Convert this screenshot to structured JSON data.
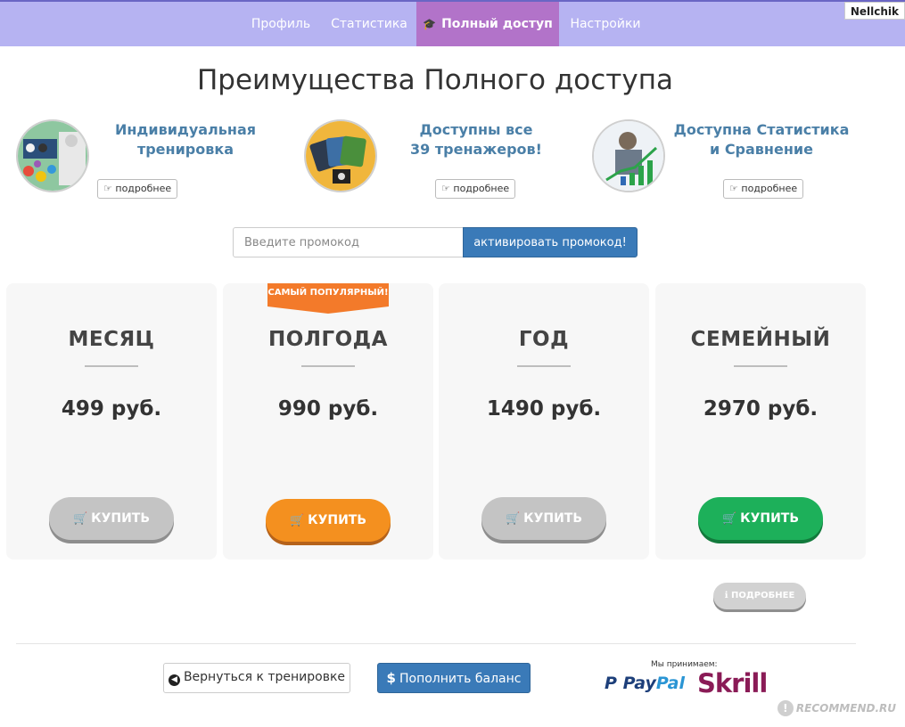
{
  "nav": {
    "items": [
      {
        "label": "Профиль"
      },
      {
        "label": "Статистика"
      },
      {
        "label": "Полный доступ"
      },
      {
        "label": "Настройки"
      }
    ],
    "active_index": 2,
    "user": "Nellchik"
  },
  "page": {
    "title": "Преимущества Полного доступа"
  },
  "features": [
    {
      "title_line1": "Индивидуальная",
      "title_line2": "тренировка",
      "more": "подробнее"
    },
    {
      "title_line1": "Доступны все",
      "title_line2": "39 тренажеров!",
      "more": "подробнее"
    },
    {
      "title_line1": "Доступна Статистика",
      "title_line2": "и Сравнение",
      "more": "подробнее"
    }
  ],
  "promo": {
    "placeholder": "Введите промокод",
    "button": "активировать промокод!"
  },
  "plans": [
    {
      "name": "МЕСЯЦ",
      "price": "499 руб.",
      "buy": "КУПИТЬ",
      "style": "gray"
    },
    {
      "name": "ПОЛГОДА",
      "price": "990 руб.",
      "buy": "КУПИТЬ",
      "style": "orange"
    },
    {
      "name": "ГОД",
      "price": "1490 руб.",
      "buy": "КУПИТЬ",
      "style": "gray"
    },
    {
      "name": "СЕМЕЙНЫЙ",
      "price": "2970 руб.",
      "buy": "КУПИТЬ",
      "style": "green"
    }
  ],
  "popular_ribbon": "САМЫЙ ПОПУЛЯРНЫЙ!",
  "family_details": "ПОДРОБНЕЕ",
  "footer": {
    "back": "Вернуться к тренировке",
    "topup": "Пополнить баланс",
    "accept": "Мы принимаем:",
    "paypal_a": "Pay",
    "paypal_b": "Pal",
    "skrill": "Skrill"
  },
  "watermark": "RECOMMEND.RU",
  "colors": {
    "nav_bg": "#b6b3f2",
    "nav_active": "#b273c9",
    "accent_blue": "#3a7ab8",
    "feature_title": "#4a7fa7",
    "orange": "#f4901f",
    "green": "#1db05a",
    "gray_button": "#c4c4c4"
  }
}
